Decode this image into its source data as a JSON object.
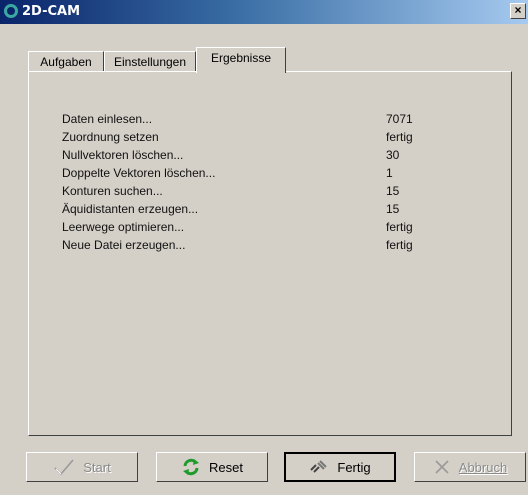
{
  "window": {
    "title": "2D-CAM",
    "close_glyph": "×"
  },
  "tabs": [
    {
      "label": "Aufgaben"
    },
    {
      "label": "Einstellungen"
    },
    {
      "label": "Ergebnisse",
      "active": true
    }
  ],
  "results": [
    {
      "label": "Daten einlesen...",
      "value": "7071"
    },
    {
      "label": "Zuordnung setzen",
      "value": "fertig"
    },
    {
      "label": "Nullvektoren löschen...",
      "value": "30"
    },
    {
      "label": "Doppelte Vektoren löschen...",
      "value": "1"
    },
    {
      "label": "Konturen suchen...",
      "value": "15"
    },
    {
      "label": "Äquidistanten erzeugen...",
      "value": "15"
    },
    {
      "label": "Leerwege optimieren...",
      "value": "fertig"
    },
    {
      "label": "Neue Datei erzeugen...",
      "value": "fertig"
    }
  ],
  "buttons": {
    "start": {
      "label": "Start",
      "enabled": false,
      "icon": "check-icon"
    },
    "reset": {
      "label": "Reset",
      "enabled": true,
      "icon": "refresh-icon"
    },
    "fertig": {
      "label": "Fertig",
      "enabled": true,
      "icon": "tool-icon"
    },
    "abbruch": {
      "label": "Abbruch",
      "enabled": false,
      "icon": "cross-icon"
    }
  },
  "colors": {
    "titlebar_start": "#0a246a",
    "titlebar_end": "#a6caf0",
    "face": "#d4d0c8",
    "reset_icon": "#1e9b2a"
  }
}
